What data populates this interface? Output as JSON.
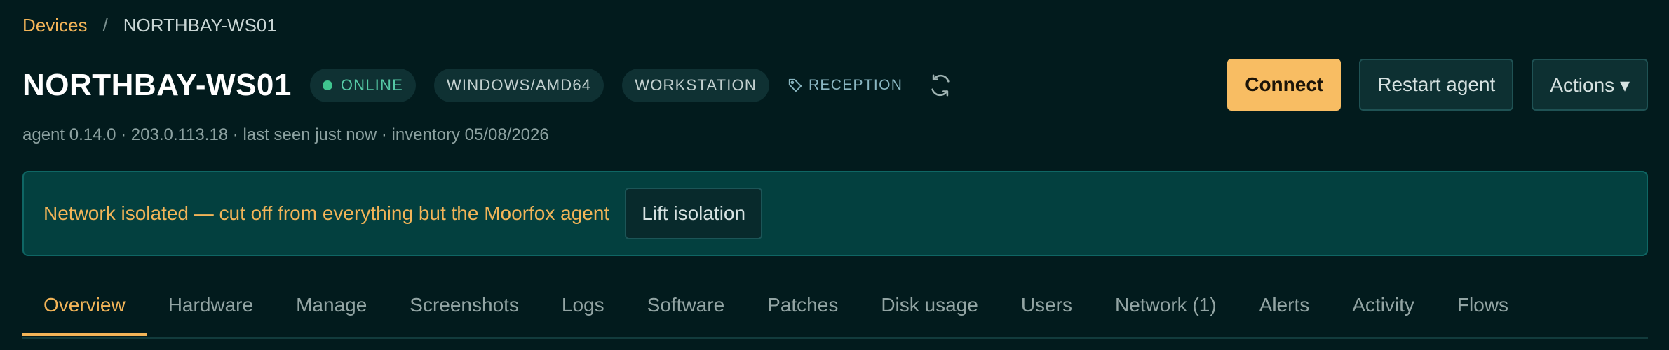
{
  "breadcrumb": {
    "parent": "Devices",
    "separator": "/",
    "current": "NORTHBAY-WS01"
  },
  "device": {
    "name": "NORTHBAY-WS01",
    "status": "ONLINE",
    "platform": "WINDOWS/AMD64",
    "role": "WORKSTATION",
    "tag": "RECEPTION",
    "meta": "agent 0.14.0 · 203.0.113.18 · last seen just now · inventory 05/08/2026"
  },
  "actions": {
    "connect": "Connect",
    "restart": "Restart agent",
    "more": "Actions ▾"
  },
  "banner": {
    "message": "Network isolated — cut off from everything but the Moorfox agent",
    "button": "Lift isolation"
  },
  "tabs": [
    {
      "label": "Overview",
      "active": true
    },
    {
      "label": "Hardware"
    },
    {
      "label": "Manage"
    },
    {
      "label": "Screenshots"
    },
    {
      "label": "Logs"
    },
    {
      "label": "Software"
    },
    {
      "label": "Patches"
    },
    {
      "label": "Disk usage"
    },
    {
      "label": "Users"
    },
    {
      "label": "Network (1)"
    },
    {
      "label": "Alerts"
    },
    {
      "label": "Activity"
    },
    {
      "label": "Flows"
    }
  ],
  "colors": {
    "background": "#021b1d",
    "accent": "#f2b458",
    "online": "#3fc58f",
    "banner": "#03403f"
  },
  "icons": {
    "tag": "tag-icon",
    "refresh": "refresh-icon"
  }
}
